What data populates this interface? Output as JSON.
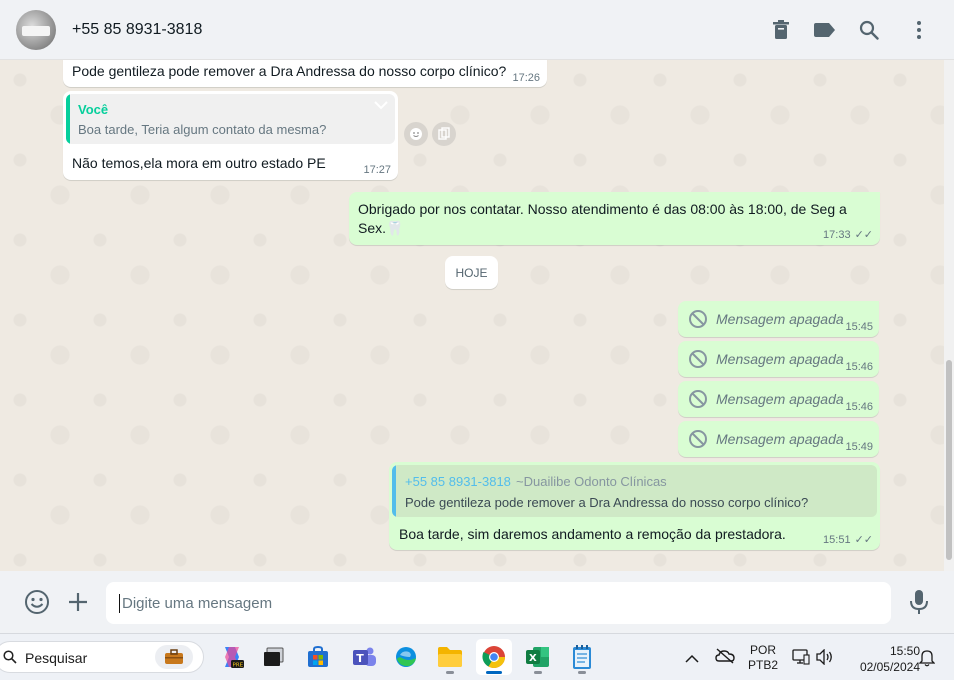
{
  "header": {
    "contact_name": "+55 85 8931-3818",
    "icons": [
      "delete-icon",
      "label-icon",
      "search-icon",
      "menu-icon"
    ]
  },
  "messages": [
    {
      "id": "m1",
      "direction": "in",
      "text": "Pode gentileza pode remover a Dra Andressa do nosso corpo clínico?",
      "time": "17:26"
    },
    {
      "id": "m2",
      "direction": "in",
      "quote_author": "Você",
      "quote_text": "Boa tarde, Teria algum contato da mesma?",
      "text": "Não temos,ela mora em outro estado PE",
      "time": "17:27"
    },
    {
      "id": "m3",
      "direction": "out",
      "text": "Obrigado por nos contatar. Nosso atendimento é das 08:00 às 18:00, de Seg a Sex.🦷",
      "time": "17:33"
    },
    {
      "id": "m4",
      "direction": "out",
      "deleted": true,
      "text": "Mensagem apagada",
      "time": "15:45"
    },
    {
      "id": "m5",
      "direction": "out",
      "deleted": true,
      "text": "Mensagem apagada",
      "time": "15:46"
    },
    {
      "id": "m6",
      "direction": "out",
      "deleted": true,
      "text": "Mensagem apagada",
      "time": "15:46"
    },
    {
      "id": "m7",
      "direction": "out",
      "deleted": true,
      "text": "Mensagem apagada",
      "time": "15:49"
    },
    {
      "id": "m8",
      "direction": "out",
      "quote_author": "+55 85 8931-3818",
      "quote_author_alias": "~Duailibe Odonto Clínicas",
      "quote_text": "Pode gentileza pode remover a Dra Andressa do nosso corpo clínico?",
      "text": "Boa tarde, sim daremos andamento a remoção da prestadora.",
      "time": "15:51"
    }
  ],
  "date_divider": "HOJE",
  "composer": {
    "placeholder": "Digite uma mensagem"
  },
  "taskbar": {
    "search_placeholder": "Pesquisar",
    "apps": [
      "briefcase-icon",
      "copilot-icon",
      "task-view-icon",
      "store-icon",
      "teams-icon",
      "edge-icon",
      "file-explorer-icon",
      "chrome-icon",
      "excel-icon",
      "notepad-icon"
    ],
    "lang_line1": "POR",
    "lang_line2": "PTB2",
    "clock_time": "15:50",
    "clock_date": "02/05/2024"
  },
  "colors": {
    "accent_green": "#25d366",
    "quote_you": "#06cf9c",
    "quote_other": "#53bdeb",
    "outgoing": "#d9fdd3"
  }
}
